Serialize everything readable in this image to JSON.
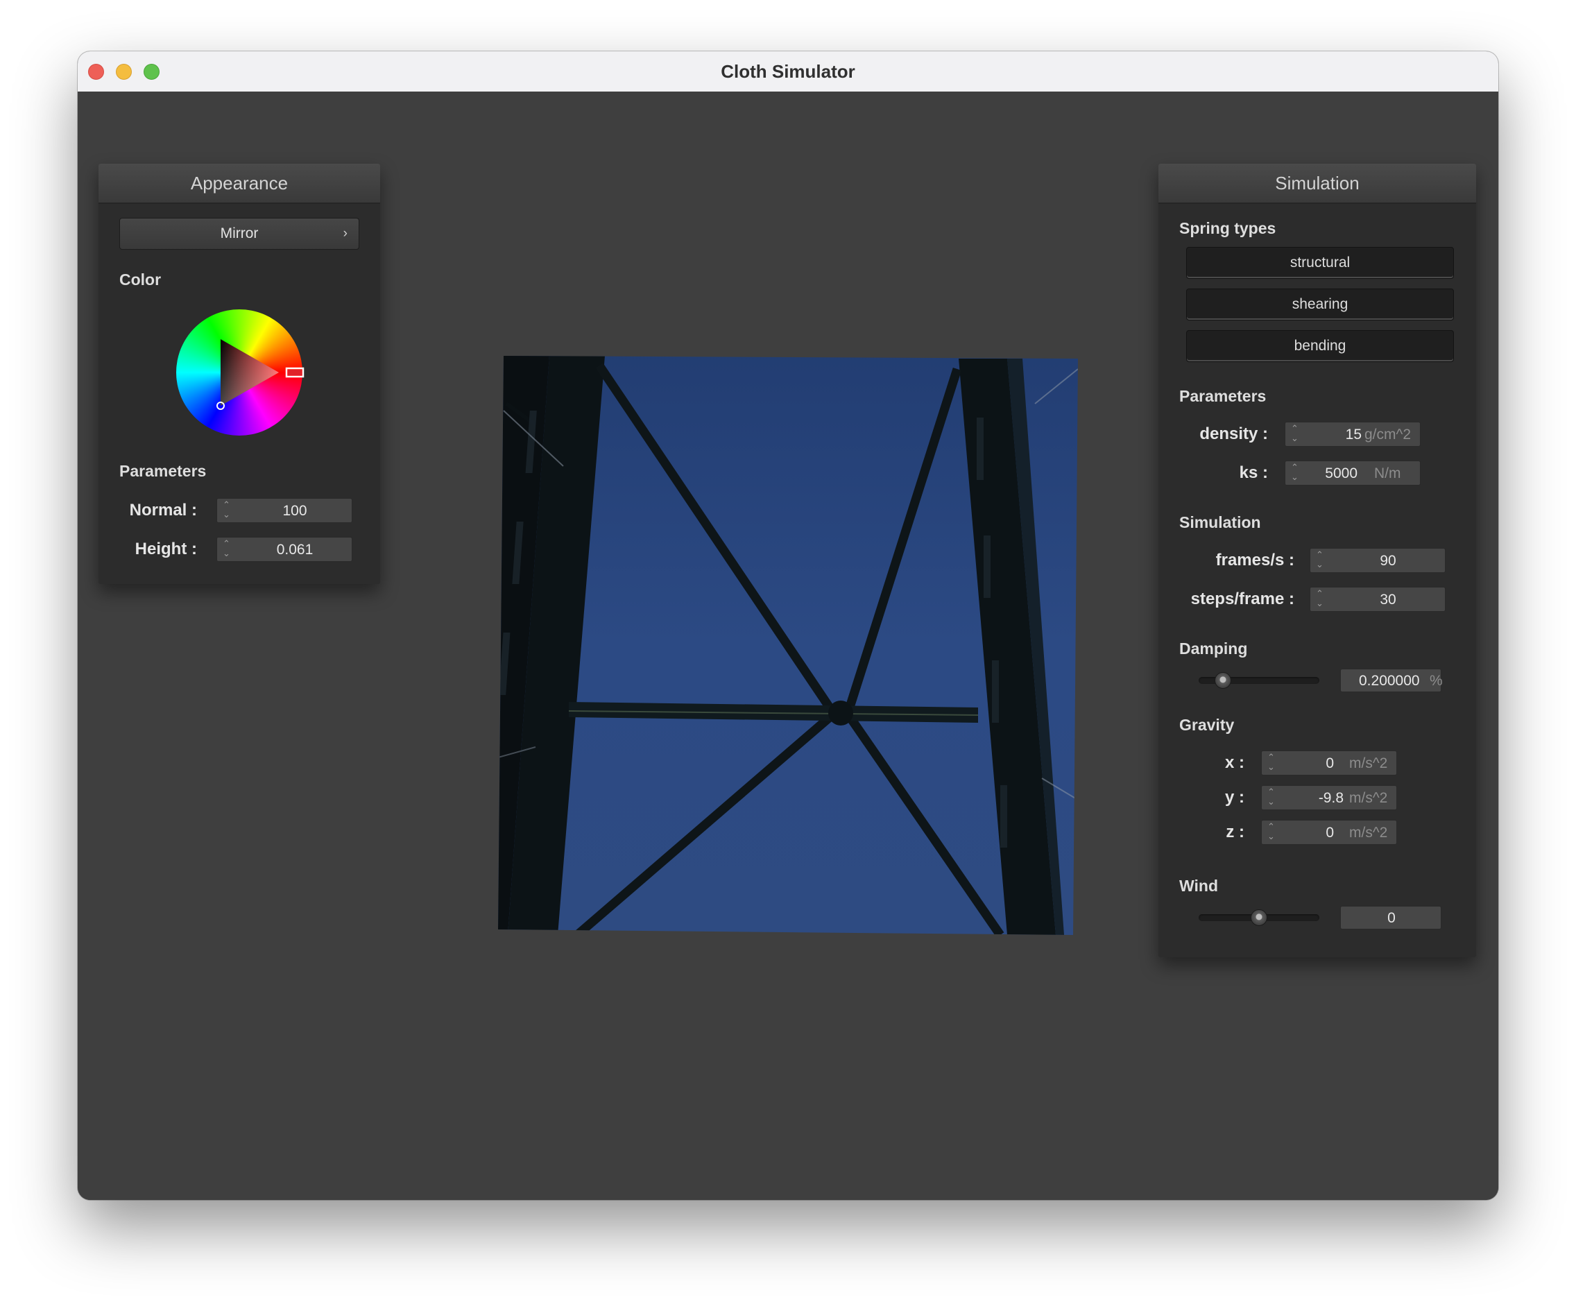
{
  "window": {
    "title": "Cloth Simulator"
  },
  "appearance": {
    "header": "Appearance",
    "shader": "Mirror",
    "color_label": "Color",
    "parameters_label": "Parameters",
    "normal_label": "Normal :",
    "normal_value": "100",
    "height_label": "Height :",
    "height_value": "0.061",
    "selected_color": "#e0222a"
  },
  "simulation": {
    "header": "Simulation",
    "spring_types_label": "Spring types",
    "spring_types": [
      "structural",
      "shearing",
      "bending"
    ],
    "parameters_label": "Parameters",
    "density_label": "density :",
    "density_value": "15",
    "density_unit": "g/cm^2",
    "ks_label": "ks :",
    "ks_value": "5000",
    "ks_unit": "N/m",
    "simulation_label": "Simulation",
    "fps_label": "frames/s :",
    "fps_value": "90",
    "steps_label": "steps/frame :",
    "steps_value": "30",
    "damping_label": "Damping",
    "damping_value": "0.200000",
    "damping_unit": "%",
    "damping_slider_fraction": 0.2,
    "gravity_label": "Gravity",
    "gx_label": "x :",
    "gx_value": "0",
    "gy_label": "y :",
    "gy_value": "-9.8",
    "gz_label": "z :",
    "gz_value": "0",
    "gravity_unit": "m/s^2",
    "wind_label": "Wind",
    "wind_value": "0",
    "wind_slider_fraction": 0.5
  },
  "colors": {
    "sky": "#2d4a82",
    "structure": "#0c1316"
  }
}
